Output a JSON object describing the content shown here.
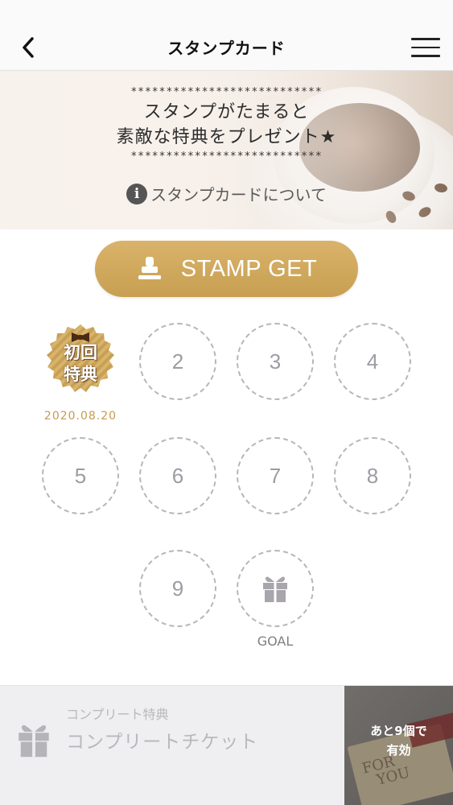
{
  "nav": {
    "title": "スタンプカード"
  },
  "banner": {
    "stars_top": "***************************",
    "line1": "スタンプがたまると",
    "line2": "素敵な特典をプレゼント★",
    "stars_bottom": "***************************",
    "about_label": "スタンプカードについて"
  },
  "stamp_button": {
    "label": "STAMP GET"
  },
  "card": {
    "first_stamp": {
      "line1": "初回",
      "line2": "特典",
      "date": "2020.08.20"
    },
    "slots": [
      {
        "label": "2"
      },
      {
        "label": "3"
      },
      {
        "label": "4"
      },
      {
        "label": "5"
      },
      {
        "label": "6"
      },
      {
        "label": "7"
      },
      {
        "label": "8"
      },
      {
        "label": "9"
      }
    ],
    "goal_label": "GOAL"
  },
  "footer": {
    "small_label": "コンプリート特典",
    "big_label": "コンプリートチケット",
    "ticket_line1": "あと9個で",
    "ticket_line2": "有効",
    "ticket_image_text1": "FOR",
    "ticket_image_text2": "YOU"
  },
  "colors": {
    "accent_gold": "#cda65b",
    "date_gold": "#c79b4e",
    "slot_border": "#b8b5bd"
  }
}
